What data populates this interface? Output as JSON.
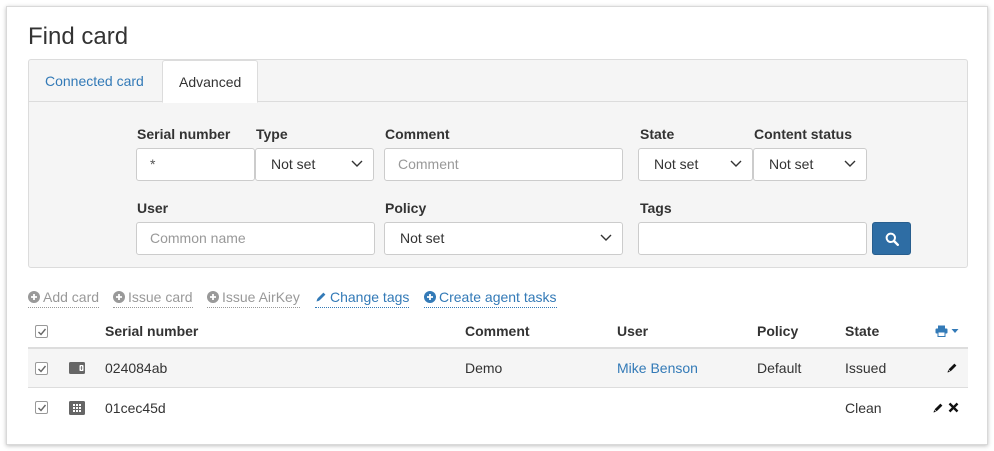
{
  "page": {
    "title": "Find card"
  },
  "tabs": [
    {
      "label": "Connected card",
      "active": false
    },
    {
      "label": "Advanced",
      "active": true
    }
  ],
  "form": {
    "serial_number": {
      "label": "Serial number",
      "value": "*"
    },
    "type": {
      "label": "Type",
      "value": "Not set"
    },
    "comment": {
      "label": "Comment",
      "placeholder": "Comment"
    },
    "state": {
      "label": "State",
      "value": "Not set"
    },
    "content_status": {
      "label": "Content status",
      "value": "Not set"
    },
    "user": {
      "label": "User",
      "placeholder": "Common name"
    },
    "policy": {
      "label": "Policy",
      "value": "Not set"
    },
    "tags": {
      "label": "Tags",
      "value": ""
    }
  },
  "actions": [
    {
      "label": "Add card",
      "enabled": false,
      "icon": "plus-circle-icon"
    },
    {
      "label": "Issue card",
      "enabled": false,
      "icon": "plus-circle-icon"
    },
    {
      "label": "Issue AirKey",
      "enabled": false,
      "icon": "plus-circle-icon"
    },
    {
      "label": "Change tags",
      "enabled": true,
      "icon": "pencil-icon"
    },
    {
      "label": "Create agent tasks",
      "enabled": true,
      "icon": "plus-circle-icon"
    }
  ],
  "table": {
    "columns": [
      "Serial number",
      "Comment",
      "User",
      "Policy",
      "State"
    ],
    "rows": [
      {
        "type_icon": "card-chip-icon",
        "serial": "024084ab",
        "comment": "Demo",
        "user": "Mike Benson",
        "policy": "Default",
        "state": "Issued",
        "checked": true
      },
      {
        "type_icon": "keypad-card-icon",
        "serial": "01cec45d",
        "comment": "",
        "user": "",
        "policy": "",
        "state": "Clean",
        "checked": true
      }
    ]
  },
  "colors": {
    "accent": "#337ab7",
    "primary_button": "#2e6da4",
    "panel_bg": "#f5f5f5"
  }
}
